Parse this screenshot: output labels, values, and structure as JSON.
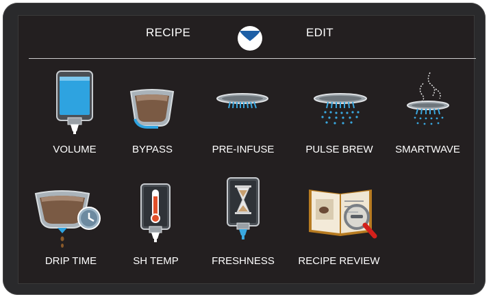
{
  "header": {
    "left_tab": "RECIPE",
    "right_tab": "EDIT",
    "logo_icon": "bunn-logo-icon"
  },
  "colors": {
    "background": "#231f20",
    "accent_blue": "#1d5fa6",
    "water_blue": "#3aa8e0",
    "coffee_brown": "#6b4a36",
    "text": "#ffffff"
  },
  "tiles": [
    {
      "label": "VOLUME",
      "icon": "volume-icon"
    },
    {
      "label": "BYPASS",
      "icon": "bypass-icon"
    },
    {
      "label": "PRE-INFUSE",
      "icon": "pre-infuse-icon"
    },
    {
      "label": "PULSE BREW",
      "icon": "pulse-brew-icon"
    },
    {
      "label": "SMARTWAVE",
      "icon": "smartwave-icon"
    },
    {
      "label": "DRIP TIME",
      "icon": "drip-time-icon"
    },
    {
      "label": "SH TEMP",
      "icon": "sh-temp-icon"
    },
    {
      "label": "FRESHNESS",
      "icon": "freshness-icon"
    },
    {
      "label": "RECIPE REVIEW",
      "icon": "recipe-review-icon"
    }
  ]
}
